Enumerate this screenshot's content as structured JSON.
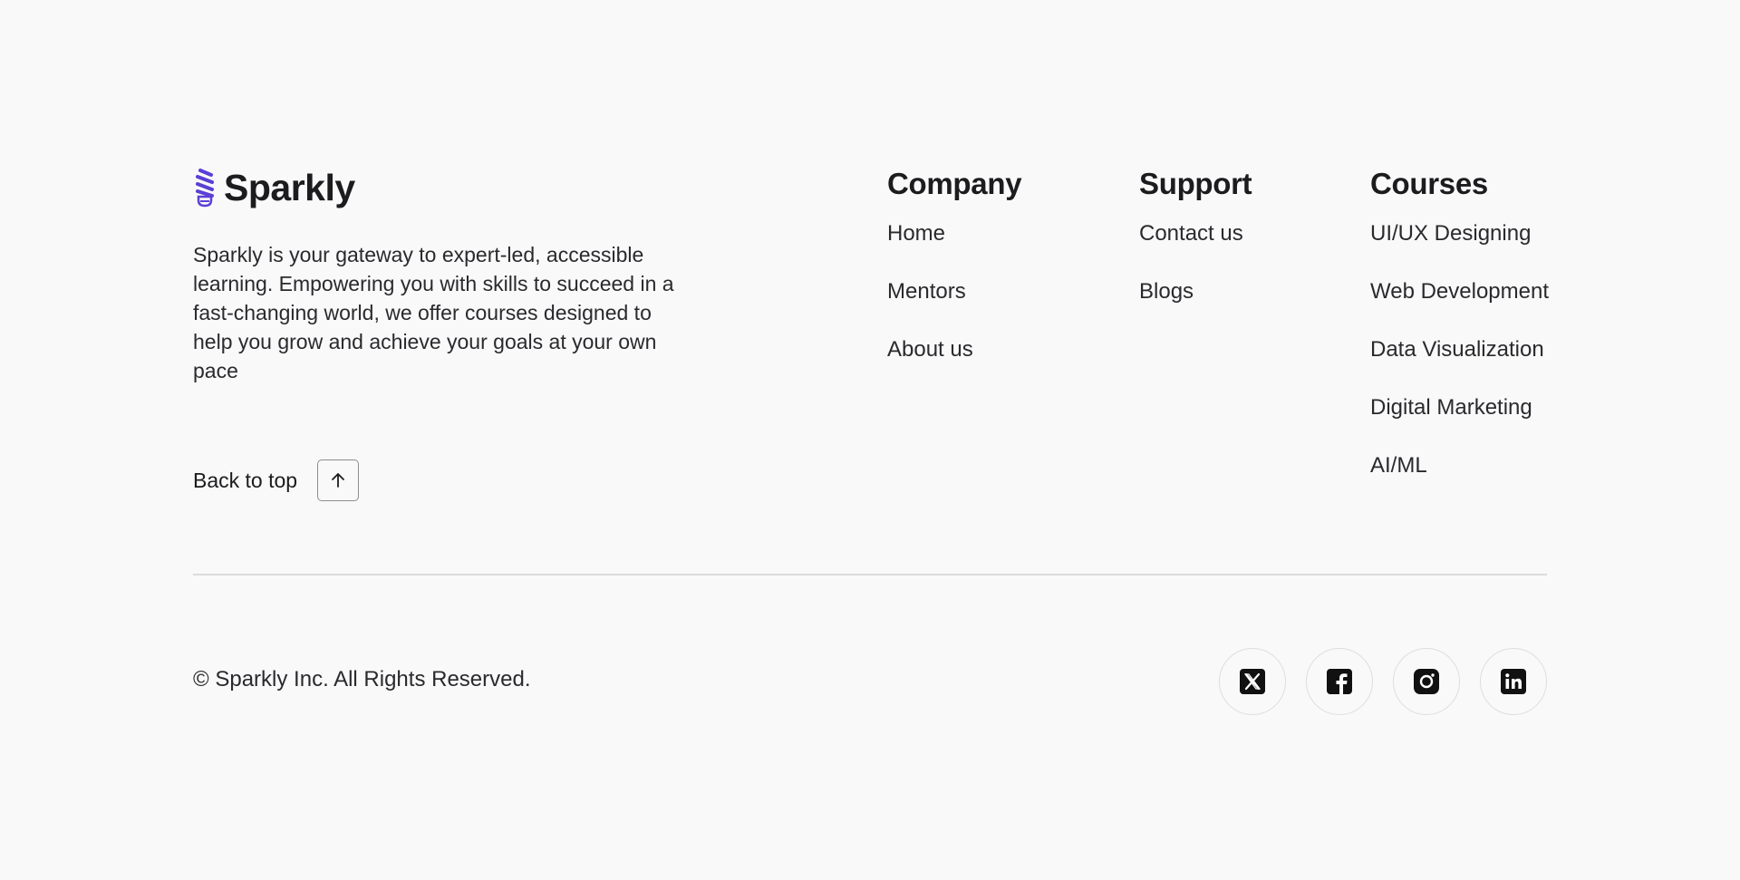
{
  "brand": {
    "name": "Sparkly",
    "accent_color": "#5b3fd6",
    "description": "Sparkly is your gateway to expert-led, accessible learning. Empowering you with skills to succeed in a fast-changing world, we offer courses designed to help you grow and achieve your goals at your own pace"
  },
  "back_to_top": {
    "label": "Back to top",
    "icon": "arrow-up-icon"
  },
  "columns": {
    "company": {
      "title": "Company",
      "links": [
        "Home",
        "Mentors",
        "About us"
      ]
    },
    "support": {
      "title": "Support",
      "links": [
        "Contact us",
        "Blogs"
      ]
    },
    "courses": {
      "title": "Courses",
      "links": [
        "UI/UX Designing",
        "Web Development",
        "Data Visualization",
        "Digital Marketing",
        "AI/ML"
      ]
    }
  },
  "copyright": "© Sparkly Inc. All Rights Reserved.",
  "socials": [
    {
      "icon": "x-twitter-icon"
    },
    {
      "icon": "facebook-icon"
    },
    {
      "icon": "instagram-icon"
    },
    {
      "icon": "linkedin-icon"
    }
  ]
}
